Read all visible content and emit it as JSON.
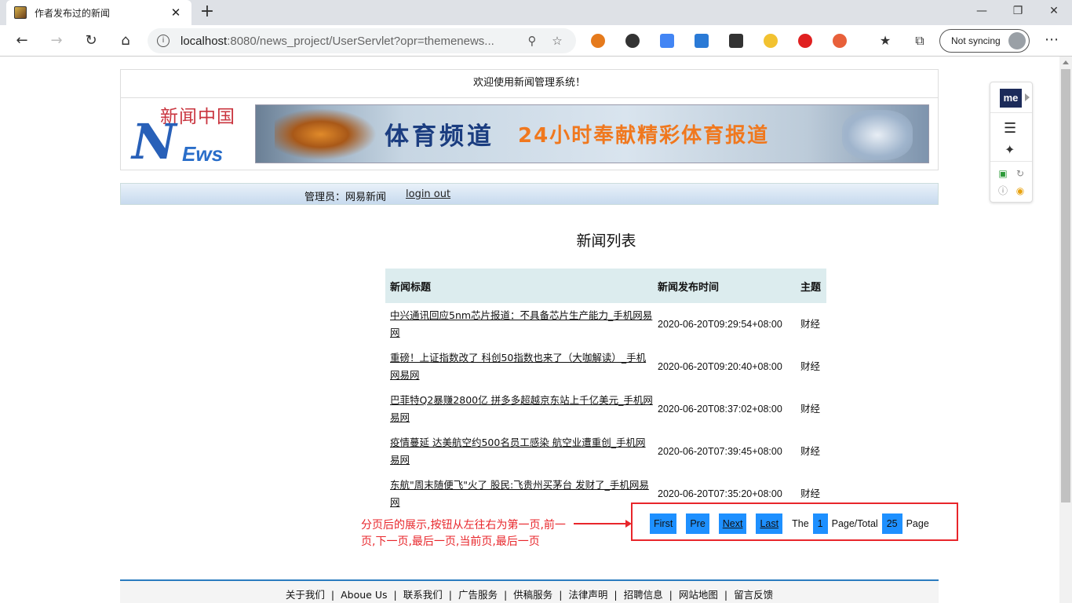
{
  "browser": {
    "tab_title": "作者发布过的新闻",
    "close_label": "✕",
    "newtab_label": "+",
    "url_host": "localhost",
    "url_rest": ":8080/news_project/UserServlet?opr=themenews...",
    "sync_label": "Not syncing",
    "icons": [
      "back-icon",
      "forward-icon",
      "refresh-icon",
      "home-icon",
      "info-icon",
      "zoom-icon",
      "favorite-star-icon",
      "collections-icon",
      "more-icon"
    ]
  },
  "header": {
    "welcome": "欢迎使用新闻管理系统！",
    "logo_cn": "新闻中国",
    "logo_n": "N",
    "logo_ews": "Ews",
    "banner_title": "体育频道",
    "banner_slogan": "24小时奉献精彩体育报道"
  },
  "userbar": {
    "admin": "管理员：网易新闻",
    "logout": "login out"
  },
  "main": {
    "list_title": "新闻列表",
    "columns": [
      "新闻标题",
      "新闻发布时间",
      "主题"
    ],
    "rows": [
      {
        "title": "中兴通讯回应5nm芯片报道：不具备芯片生产能力_手机网易网",
        "time": "2020-06-20T09:29:54+08:00",
        "theme": "财经"
      },
      {
        "title": "重磅！上证指数改了 科创50指数也来了（大咖解读）_手机网易网",
        "time": "2020-06-20T09:20:40+08:00",
        "theme": "财经"
      },
      {
        "title": "巴菲特Q2暴赚2800亿 拼多多超越京东站上千亿美元_手机网易网",
        "time": "2020-06-20T08:37:02+08:00",
        "theme": "财经"
      },
      {
        "title": "疫情蔓延 达美航空约500名员工感染 航空业遭重创_手机网易网",
        "time": "2020-06-20T07:39:45+08:00",
        "theme": "财经"
      },
      {
        "title": "东航\"周末随便飞\"火了 股民:飞贵州买茅台 发财了_手机网易网",
        "time": "2020-06-20T07:35:20+08:00",
        "theme": "财经"
      }
    ]
  },
  "pager": {
    "first": "First",
    "pre": "Pre",
    "next": "Next",
    "last": "Last",
    "the": "The",
    "current": "1",
    "page_total": "Page/Total",
    "total": "25",
    "page": "Page"
  },
  "annotation": {
    "text": "分页后的展示,按钮从左往右为第一页,前一页,下一页,最后一页,当前页,最后一页"
  },
  "footer": {
    "links": [
      "关于我们",
      "Aboue Us",
      "联系我们",
      "广告服务",
      "供稿服务",
      "法律声明",
      "招聘信息",
      "网站地图",
      "留言反馈"
    ]
  },
  "sidepanel": {
    "me_label": "me"
  }
}
